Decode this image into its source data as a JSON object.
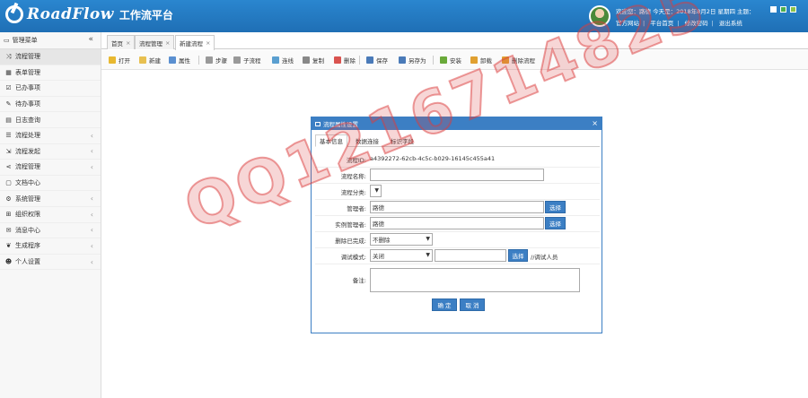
{
  "header": {
    "logo_text": "RoadFlow",
    "logo_sub": "工作流平台",
    "user_line": "欢迎您：路德  今天是：2018年8月2日 星期四  主题：",
    "links": [
      "官方网站",
      "平台首页",
      "修改密码",
      "退出系统"
    ],
    "theme_colors": [
      "#ffffff",
      "#4caf50",
      "#8bc34a"
    ]
  },
  "sidebar": {
    "title": "管理菜单",
    "collapse": "«",
    "items": [
      {
        "label": "流程管理",
        "icon": "shuffle-icon",
        "glyph": "⤨",
        "chev": false,
        "active": true
      },
      {
        "label": "表单管理",
        "icon": "table-icon",
        "glyph": "▦",
        "chev": false
      },
      {
        "label": "已办事项",
        "icon": "checkbox-icon",
        "glyph": "☑",
        "chev": false
      },
      {
        "label": "待办事项",
        "icon": "edit-icon",
        "glyph": "✎",
        "chev": false
      },
      {
        "label": "日志查询",
        "icon": "file-icon",
        "glyph": "▤",
        "chev": false
      },
      {
        "label": "流程处理",
        "icon": "list-icon",
        "glyph": "☰",
        "chev": true
      },
      {
        "label": "流程发起",
        "icon": "send-icon",
        "glyph": "⇲",
        "chev": true
      },
      {
        "label": "流程管理",
        "icon": "share-icon",
        "glyph": "⋖",
        "chev": true
      },
      {
        "label": "文档中心",
        "icon": "document-icon",
        "glyph": "▢",
        "chev": false
      },
      {
        "label": "系统管理",
        "icon": "gear-icon",
        "glyph": "⚙",
        "chev": true
      },
      {
        "label": "组织权限",
        "icon": "sitemap-icon",
        "glyph": "⊞",
        "chev": true
      },
      {
        "label": "消息中心",
        "icon": "comments-icon",
        "glyph": "✉",
        "chev": true
      },
      {
        "label": "生成程序",
        "icon": "leaf-icon",
        "glyph": "❦",
        "chev": true
      },
      {
        "label": "个人设置",
        "icon": "user-icon",
        "glyph": "☻",
        "chev": true
      }
    ]
  },
  "tabs": [
    {
      "label": "首页",
      "close": "×"
    },
    {
      "label": "流程管理",
      "close": "×"
    },
    {
      "label": "新建流程",
      "close": "×",
      "active": true
    }
  ],
  "toolbar": [
    {
      "label": "打开",
      "icon": "folder-open-icon",
      "color": "#e8b830"
    },
    {
      "label": "新建",
      "icon": "new-icon",
      "color": "#e8c050"
    },
    {
      "label": "属性",
      "icon": "properties-icon",
      "color": "#5a8fd0"
    },
    {
      "label": "步骤",
      "icon": "step-icon",
      "color": "#999999"
    },
    {
      "label": "子流程",
      "icon": "subflow-icon",
      "color": "#999999"
    },
    {
      "label": "连线",
      "icon": "line-icon",
      "color": "#5a9fd0"
    },
    {
      "label": "复制",
      "icon": "copy-icon",
      "color": "#888888"
    },
    {
      "label": "删除",
      "icon": "delete-icon",
      "color": "#d9534f"
    },
    {
      "label": "保存",
      "icon": "save-icon",
      "color": "#4a7ab8"
    },
    {
      "label": "另存为",
      "icon": "save-as-icon",
      "color": "#4a7ab8"
    },
    {
      "label": "安装",
      "icon": "install-icon",
      "color": "#6aaa3a"
    },
    {
      "label": "卸载",
      "icon": "uninstall-icon",
      "color": "#e0a030"
    },
    {
      "label": "删除流程",
      "icon": "delete-flow-icon",
      "color": "#e0a030"
    }
  ],
  "dialog": {
    "title": "流程属性设置",
    "close": "×",
    "tabs": [
      "基本信息",
      "数据连接",
      "标识字段"
    ],
    "fields": {
      "flow_id_label": "流程ID:",
      "flow_id_value": "a4392272-62cb-4c5c-b029-16145c455a41",
      "name_label": "流程名称:",
      "name_value": "",
      "category_label": "流程分类:",
      "category_value": "",
      "manager_label": "管理者:",
      "manager_value": "路德",
      "instance_manager_label": "实例管理者:",
      "instance_manager_value": "路德",
      "delete_completed_label": "删除已完成:",
      "delete_completed_value": "不删除",
      "debug_label": "调试模式:",
      "debug_value": "关闭",
      "debug_user_value": "",
      "debug_users_text": "//调试人员",
      "remark_label": "备注:",
      "remark_value": "",
      "select_label": "选择"
    },
    "ok_label": "确 定",
    "cancel_label": "取 消"
  },
  "watermark": "QQ1216714825"
}
